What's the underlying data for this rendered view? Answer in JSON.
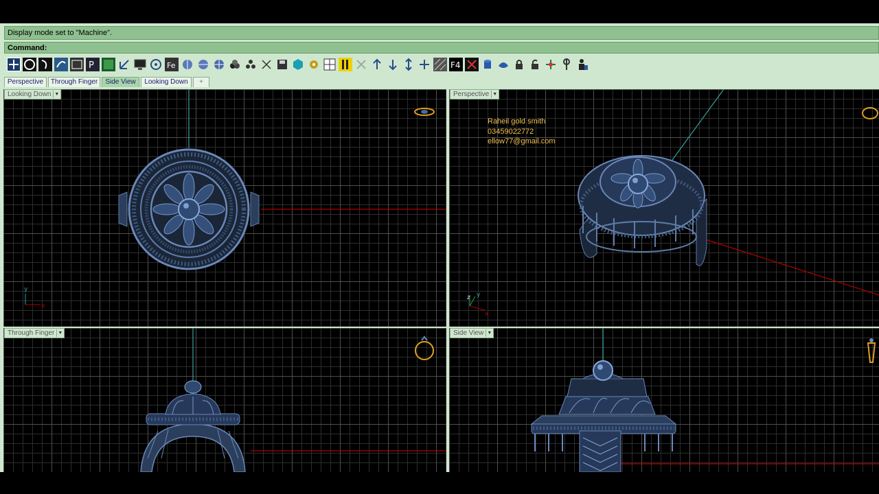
{
  "command_history": "Display mode set to \"Machine\".",
  "command_prompt": "Command:",
  "toolbar_icons": [
    "move-icon",
    "circle-icon",
    "curve-icon",
    "gem-icon",
    "capture-icon",
    "parametric-icon",
    "render-icon",
    "axis-icon",
    "monitor-icon",
    "target-icon",
    "text-icon",
    "sphere-mirror-icon",
    "sphere-section-icon",
    "globe-icon",
    "material-icon",
    "explode-icon",
    "save-icon",
    "cube-icon",
    "gear-icon",
    "layout-icon",
    "pen-icon",
    "grid-icon",
    "arrow-up-icon",
    "arrow-left-icon",
    "arrow-down-icon",
    "arrow-down-left-icon",
    "wireframe-icon",
    "f4-icon",
    "close-view-icon",
    "cylinder-icon",
    "boolean-icon",
    "lock-icon",
    "unlock-icon",
    "pivot-icon",
    "pin-icon",
    "person-icon"
  ],
  "tabs": [
    "Perspective",
    "Through Finger",
    "Side View",
    "Looking Down",
    "+"
  ],
  "active_tab": "Side View",
  "viewports": {
    "top_left": {
      "label": "Looking Down"
    },
    "top_right": {
      "label": "Perspective"
    },
    "bottom_left": {
      "label": "Through Finger"
    },
    "bottom_right": {
      "label": "Side View"
    }
  },
  "overlay": {
    "line1": "Raheil gold smith",
    "line2": "03459022772",
    "line3": "ellow77@gmail.com"
  },
  "axes": {
    "x": "x",
    "y": "y",
    "z": "z"
  },
  "colors": {
    "app_bg": "#cfe7cf",
    "command_bar": "#8fc08f",
    "viewport_bg": "#000000",
    "model": "#2b3e5c",
    "x_axis": "#b00000",
    "y_axis": "#3aa0a0",
    "overlay_text": "#f0c050"
  }
}
